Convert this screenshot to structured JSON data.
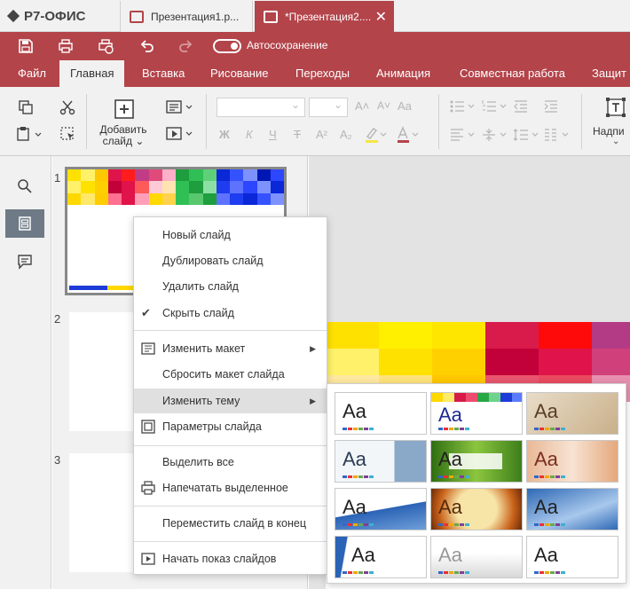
{
  "app": {
    "logo": "Р7-ОФИС"
  },
  "tabs": [
    {
      "label": "Презентация1.p..."
    },
    {
      "label": "*Презентация2....",
      "close": "✕"
    }
  ],
  "qat": {
    "autosave_label": "Автосохранение"
  },
  "ribbon": {
    "tabs": [
      "Файл",
      "Главная",
      "Вставка",
      "Рисование",
      "Переходы",
      "Анимация",
      "Совместная работа",
      "Защит"
    ],
    "active_tab": "Главная",
    "add_slide_label": "Добавить слайд",
    "textbox_label": "Надпи",
    "format": {
      "bold": "Ж",
      "italic": "К",
      "underline": "Ч",
      "strike": "Т",
      "sup": "A²",
      "sub": "A₂",
      "aa": "Aa"
    }
  },
  "slides": {
    "numbers": [
      "1",
      "2",
      "3"
    ]
  },
  "context_menu": {
    "items": [
      "Новый слайд",
      "Дублировать слайд",
      "Удалить слайд",
      "Скрыть слайд",
      "Изменить макет",
      "Сбросить макет слайда",
      "Изменить тему",
      "Параметры слайда",
      "Выделить все",
      "Напечатать выделенное",
      "Переместить слайд в конец",
      "Начать показ слайдов"
    ],
    "checked": "Скрыть слайд",
    "highlighted": "Изменить тему"
  },
  "themes": {
    "sample_text": "Aa",
    "count": 12
  },
  "colors": {
    "accent": "#b3444a",
    "toolbar": "#f1f1f1",
    "canvas": "#e3e3e3"
  }
}
